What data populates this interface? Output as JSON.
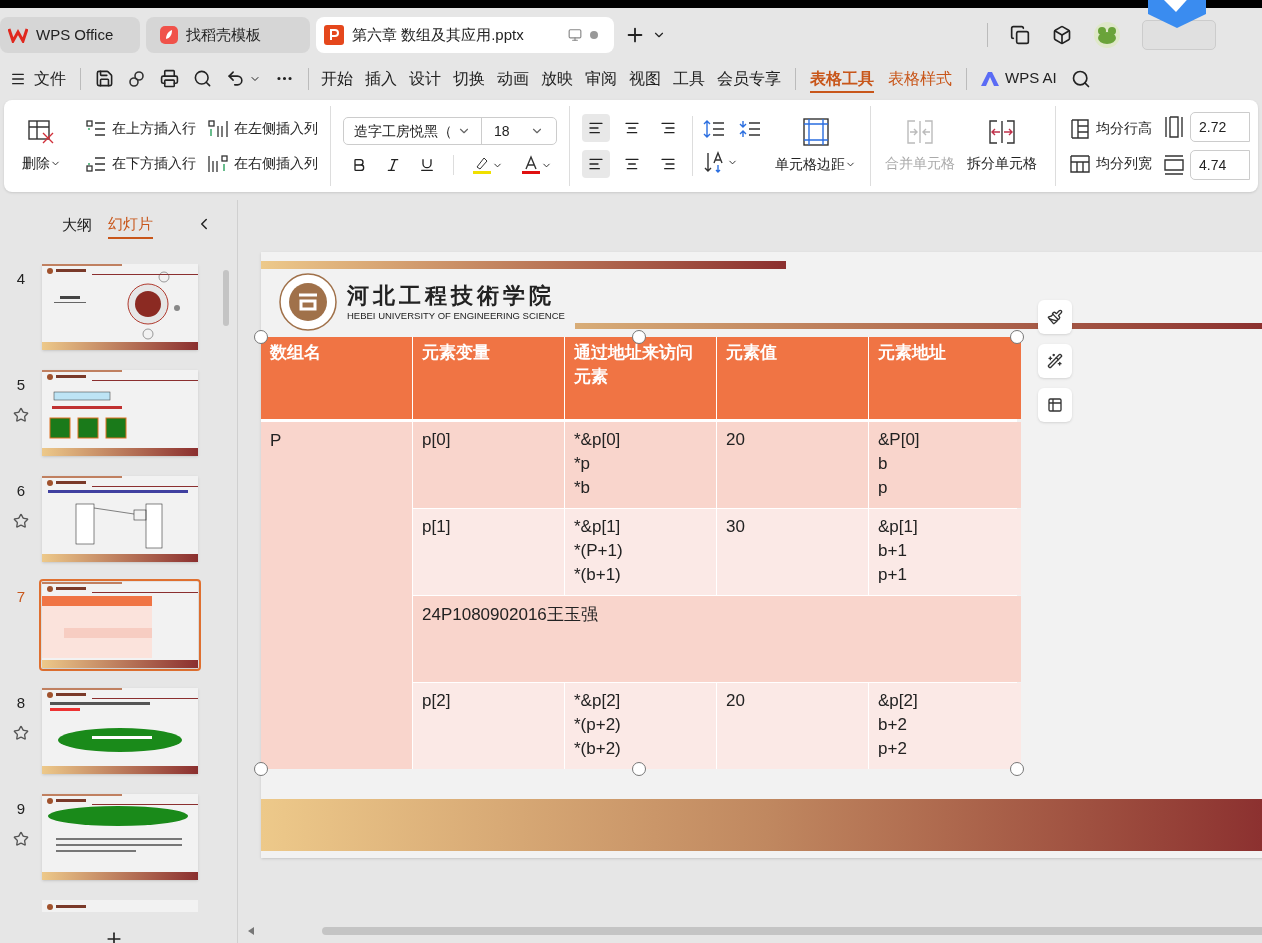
{
  "tabs": [
    {
      "label": "WPS Office",
      "kind": "home",
      "selected": false
    },
    {
      "label": "找稻壳模板",
      "kind": "template",
      "selected": false
    },
    {
      "label": "第六章 数组及其应用.pptx",
      "kind": "document",
      "selected": true
    }
  ],
  "menu": {
    "file": "文件",
    "items": [
      "开始",
      "插入",
      "设计",
      "切换",
      "动画",
      "放映",
      "审阅",
      "视图",
      "工具",
      "会员专享"
    ],
    "context_tabs": [
      {
        "label": "表格工具",
        "selected": true
      },
      {
        "label": "表格样式",
        "selected": false
      }
    ],
    "ai": "WPS AI"
  },
  "ribbon": {
    "delete": "删除",
    "insert_rows": [
      "在上方插入行",
      "在下方插入行"
    ],
    "insert_cols": [
      "在左侧插入列",
      "在右侧插入列"
    ],
    "font": "造字工房悦黑（",
    "size": "18",
    "cell_margin": "单元格边距",
    "merge": {
      "label": "合并单元格",
      "disabled": true
    },
    "split": {
      "label": "拆分单元格",
      "disabled": false
    },
    "row_height": "均分行高",
    "col_width": "均分列宽",
    "height_value": "2.72",
    "width_value": "4.74"
  },
  "panel": {
    "tabs": [
      {
        "label": "大纲",
        "selected": false
      },
      {
        "label": "幻灯片",
        "selected": true
      }
    ],
    "slides": [
      {
        "number": "4",
        "kind": "section",
        "animated": false,
        "selected": false
      },
      {
        "number": "5",
        "kind": "diagram",
        "animated": true,
        "selected": false
      },
      {
        "number": "6",
        "kind": "memory",
        "animated": true,
        "selected": false
      },
      {
        "number": "7",
        "kind": "table",
        "animated": false,
        "selected": true
      },
      {
        "number": "8",
        "kind": "cloud",
        "animated": true,
        "selected": false
      },
      {
        "number": "9",
        "kind": "banner",
        "animated": true,
        "selected": false
      }
    ]
  },
  "slide": {
    "school": "河北工程技術学院",
    "school_en": "HEBEI UNIVERSITY OF ENGINEERING SCIENCE",
    "table": {
      "columns": [
        "数组名",
        "元素变量",
        "通过地址来访问元素",
        "元素值",
        "元素地址"
      ],
      "array_name": "P",
      "rows": [
        {
          "kind": "element",
          "cells": [
            [
              "p[0]"
            ],
            [
              "*&p[0]",
              "*p",
              "*b"
            ],
            [
              "20"
            ],
            [
              "&P[0]",
              "b",
              "p"
            ]
          ]
        },
        {
          "kind": "element",
          "cells": [
            [
              "p[1]"
            ],
            [
              "*&p[1]",
              "*(P+1)",
              "*(b+1)"
            ],
            [
              "30"
            ],
            [
              "&p[1]",
              "b+1",
              "p+1"
            ]
          ]
        },
        {
          "kind": "merged",
          "text": "24P1080902016王玉强"
        },
        {
          "kind": "element",
          "cells": [
            [
              "p[2]"
            ],
            [
              "*&p[2]",
              "*(p+2)",
              "*(b+2)"
            ],
            [
              "20"
            ],
            [
              "&p[2]",
              "b+2",
              "p+2"
            ]
          ]
        }
      ]
    }
  }
}
